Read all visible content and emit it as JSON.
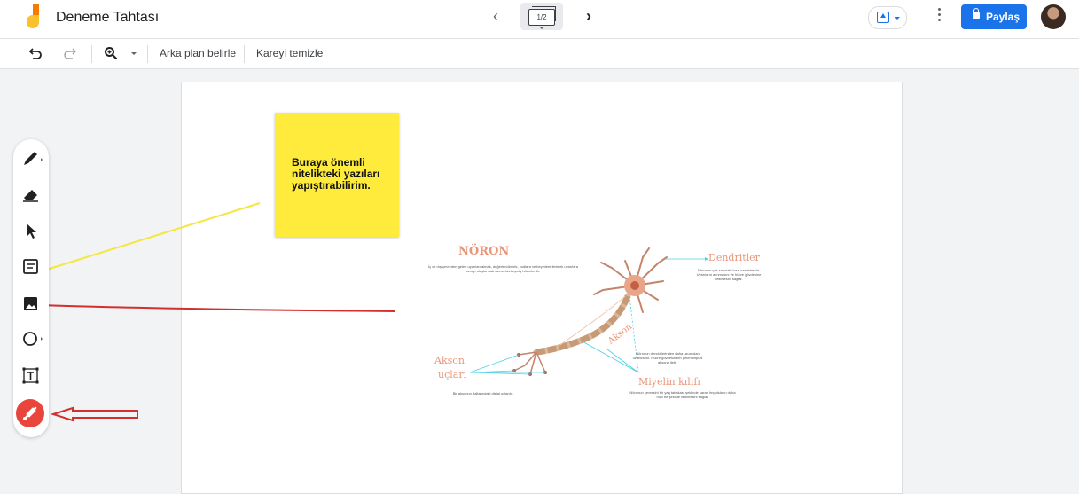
{
  "app": {
    "title": "Deneme Tahtası",
    "frame_indicator": "1/2",
    "share_label": "Paylaş"
  },
  "toolbar": {
    "set_background": "Arka plan belirle",
    "clear_frame": "Kareyi temizle"
  },
  "sticky_note": {
    "text": "Buraya önemli nitelikteki yazıları yapıştırabilirim."
  },
  "neuron_diagram": {
    "title": "NÖRON",
    "intro": "İç ve dış çevreden gelen uyarıları almak, değerlendirmek, kodlara ve beyinlere iletmek uyarılara cevap oluşturmak üzere özelleşmiş hücrelerdir.",
    "dendrites_label": "Dendritler",
    "dendrites_desc": "Nöronun çok sayıdaki kısa uzantılarıdır. Uyarıların alınmasını ve hücre gövdesine iletilmesini sağlar.",
    "axon_label": "Akson",
    "axon_desc": "Nöronun dendritlerinden daha uzun olan uzantısıdır. Hücre gövdesinden gelen impuls aksona iletir.",
    "axon_terminals_label_1": "Akson",
    "axon_terminals_label_2": "uçları",
    "axon_terminals_desc": "Bir aksonun dallarındaki distal uçlardır.",
    "myelin_label": "Miyelin kılıfı",
    "myelin_desc": "Nöronun çevresini bir yağ tabakası şeklinde sarar. İmpulsların daha hızlı bir şekilde iletilmesini sağlar."
  },
  "colors": {
    "accent_blue": "#1a73e8",
    "sticky_yellow": "#ffeb3b",
    "laser_red": "#e8453c",
    "annotation_yellow": "#f5e642",
    "annotation_red": "#d32f2f"
  },
  "icons": [
    "jamboard-logo",
    "chevron-left-icon",
    "frames-icon",
    "chevron-right-icon",
    "upload-icon",
    "more-vert-icon",
    "lock-icon",
    "undo-icon",
    "redo-icon",
    "zoom-icon",
    "pen-icon",
    "eraser-icon",
    "select-icon",
    "sticky-note-icon",
    "image-icon",
    "shape-icon",
    "text-box-icon",
    "laser-icon"
  ]
}
